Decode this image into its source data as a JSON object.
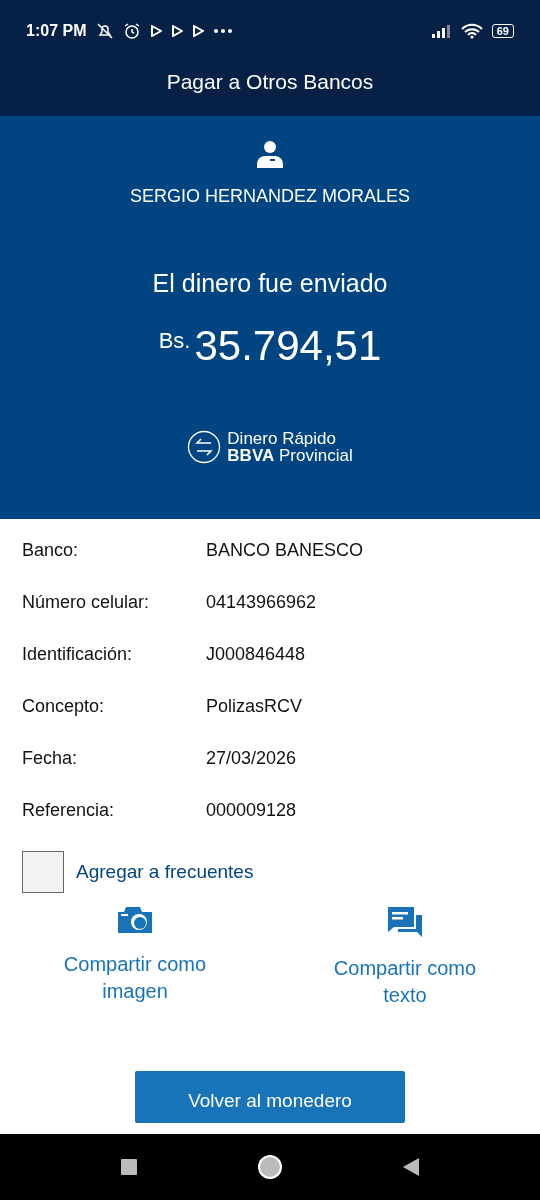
{
  "status_bar": {
    "time": "1:07 PM",
    "battery": "69"
  },
  "header": {
    "title": "Pagar a Otros Bancos"
  },
  "hero": {
    "recipient": "SERGIO HERNANDEZ MORALES",
    "message": "El dinero fue enviado",
    "currency": "Bs.",
    "amount": "35.794,51",
    "brand_line_1": "Dinero Rápido",
    "brand_line_2": "**BBVA** Provincial"
  },
  "details": [
    {
      "label": "Banco:",
      "value": "BANCO BANESCO"
    },
    {
      "label": "Número celular:",
      "value": "04143966962"
    },
    {
      "label": "Identificación:",
      "value": "J000846448"
    },
    {
      "label": "Concepto:",
      "value": "PolizasRCV"
    },
    {
      "label": "Fecha:",
      "value": "27/03/2026"
    },
    {
      "label": "Referencia:",
      "value": "000009128"
    }
  ],
  "favorite": {
    "label": "Agregar a frecuentes",
    "checked": false
  },
  "share_actions": [
    {
      "kind": "camera",
      "label": "Compartir como imagen"
    },
    {
      "kind": "chat",
      "label": "Compartir como texto"
    }
  ],
  "primary_button": {
    "label": "Volver al monedero"
  }
}
